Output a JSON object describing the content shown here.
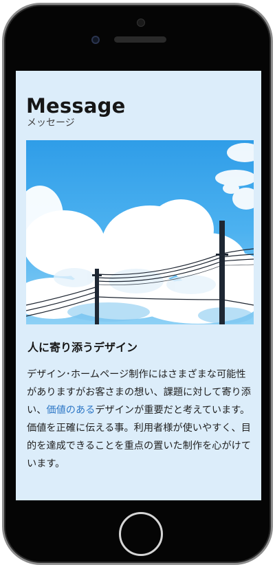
{
  "page": {
    "title": "Message",
    "subtitle": "メッセージ",
    "heading": "人に寄り添うデザイン",
    "body_part1": "デザイン･ホームページ制作にはさまざまな可能性がありますがお客さまの想い、課題に対して寄り添い、",
    "body_link": "価値のある",
    "body_part2": "デザインが重要だと考えています。",
    "body_part3": "価値を正確に伝える事。利用者様が使いやすく、目的を達成できることを重点の置いた制作を心がけています。"
  },
  "colors": {
    "screen_background": "#dcedfa",
    "link": "#2d77c6",
    "sky": "#47aef0"
  },
  "icons": {
    "hero": "sky-clouds-power-lines-photo"
  }
}
